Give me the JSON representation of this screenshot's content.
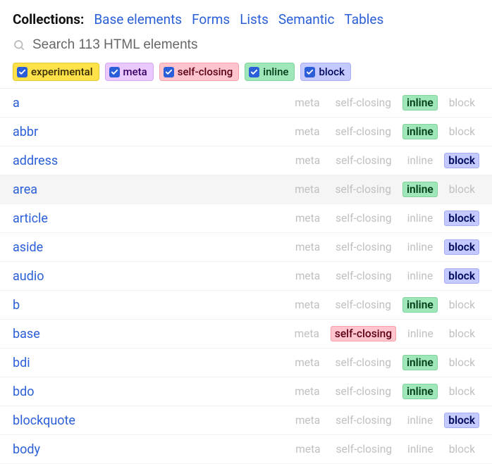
{
  "header": {
    "collections_label": "Collections:",
    "links": [
      "Base elements",
      "Forms",
      "Lists",
      "Semantic",
      "Tables"
    ]
  },
  "search": {
    "placeholder": "Search 113 HTML elements"
  },
  "filters": [
    {
      "key": "experimental",
      "label": "experimental",
      "chip_class": "chip-experimental"
    },
    {
      "key": "meta",
      "label": "meta",
      "chip_class": "chip-meta"
    },
    {
      "key": "selfclosing",
      "label": "self-closing",
      "chip_class": "chip-selfclosing"
    },
    {
      "key": "inline",
      "label": "inline",
      "chip_class": "chip-inline"
    },
    {
      "key": "block",
      "label": "block",
      "chip_class": "chip-block"
    }
  ],
  "tag_labels": {
    "meta": "meta",
    "selfclosing": "self-closing",
    "inline": "inline",
    "block": "block"
  },
  "elements": [
    {
      "name": "a",
      "active": [
        "inline"
      ],
      "hover": false
    },
    {
      "name": "abbr",
      "active": [
        "inline"
      ],
      "hover": false
    },
    {
      "name": "address",
      "active": [
        "block"
      ],
      "hover": false
    },
    {
      "name": "area",
      "active": [
        "inline"
      ],
      "hover": true
    },
    {
      "name": "article",
      "active": [
        "block"
      ],
      "hover": false
    },
    {
      "name": "aside",
      "active": [
        "block"
      ],
      "hover": false
    },
    {
      "name": "audio",
      "active": [
        "block"
      ],
      "hover": false
    },
    {
      "name": "b",
      "active": [
        "inline"
      ],
      "hover": false
    },
    {
      "name": "base",
      "active": [
        "selfclosing"
      ],
      "hover": false
    },
    {
      "name": "bdi",
      "active": [
        "inline"
      ],
      "hover": false
    },
    {
      "name": "bdo",
      "active": [
        "inline"
      ],
      "hover": false
    },
    {
      "name": "blockquote",
      "active": [
        "block"
      ],
      "hover": false
    },
    {
      "name": "body",
      "active": [],
      "hover": false
    }
  ]
}
